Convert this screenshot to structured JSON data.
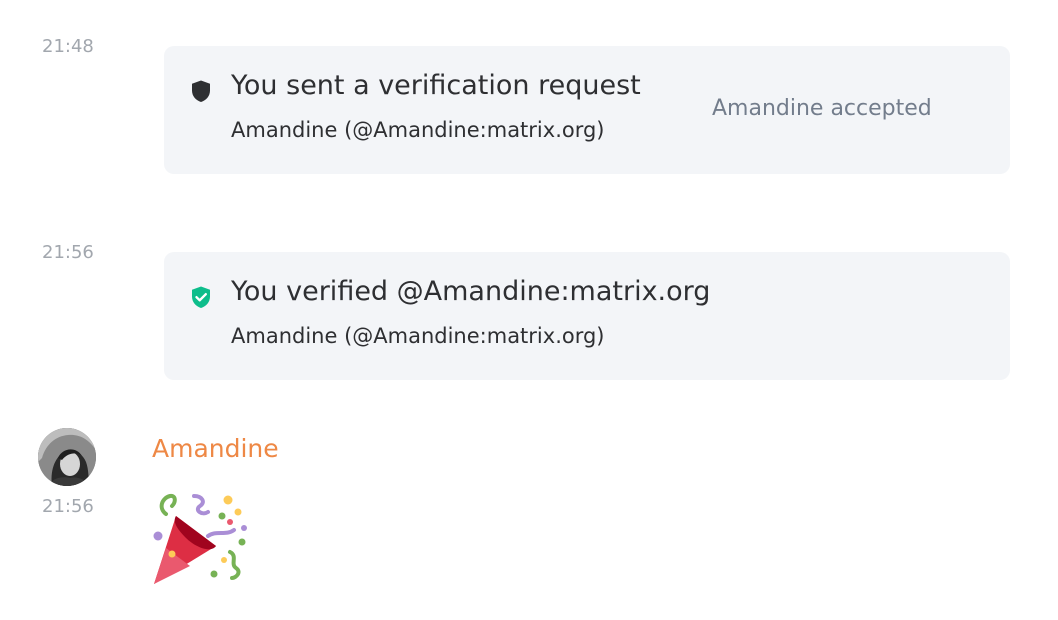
{
  "timeline": {
    "events": [
      {
        "timestamp": "21:48",
        "title": "You sent a verification request",
        "subtitle": "Amandine (@Amandine:matrix.org)",
        "status": "Amandine accepted",
        "icon": "shield-icon"
      },
      {
        "timestamp": "21:56",
        "title": "You verified @Amandine:matrix.org",
        "subtitle": "Amandine (@Amandine:matrix.org)",
        "icon": "shield-check-icon"
      }
    ],
    "message": {
      "timestamp": "21:56",
      "sender": "Amandine",
      "body_icon": "party-popper-icon"
    }
  },
  "colors": {
    "card_background": "#f3f5f8",
    "sender": "#ee8845",
    "verified_shield": "#0dbd8b",
    "shield": "#2e2f32",
    "status_text": "#737d8c",
    "timestamp_text": "#a2a7ae"
  }
}
